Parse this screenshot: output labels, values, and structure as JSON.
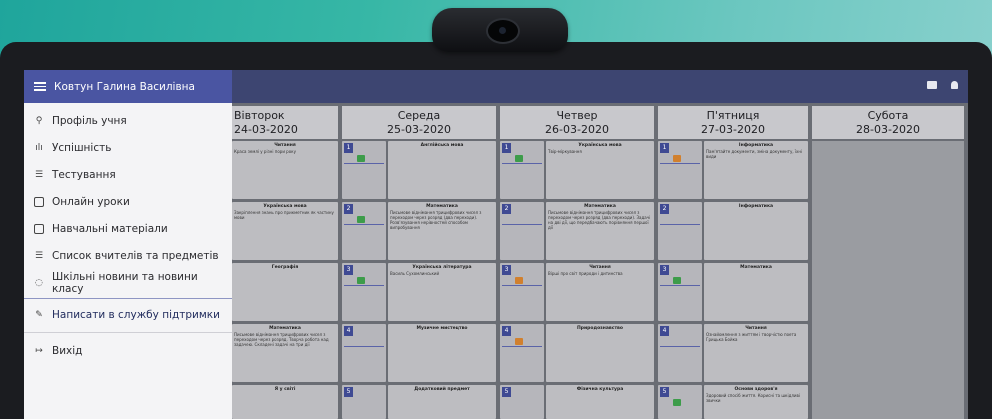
{
  "user": {
    "name": "Ковтун Галина Василівна"
  },
  "topbar": {
    "icons": [
      "mail-icon",
      "bell-icon"
    ]
  },
  "sidebar": {
    "items": [
      {
        "label": "Профіль учня",
        "icon": "person-icon"
      },
      {
        "label": "Успішність",
        "icon": "bar-chart-icon"
      },
      {
        "label": "Тестування",
        "icon": "list-icon"
      },
      {
        "label": "Онлайн уроки",
        "icon": "video-icon"
      },
      {
        "label": "Навчальні матеріали",
        "icon": "book-icon"
      },
      {
        "label": "Список вчителів та предметів",
        "icon": "list-icon"
      },
      {
        "label": "Шкільні новини та новини класу",
        "icon": "chat-icon"
      },
      {
        "label": "Написати в службу підтримки",
        "icon": "pencil-icon"
      },
      {
        "label": "Вихід",
        "icon": "logout-icon"
      }
    ]
  },
  "days": [
    {
      "name": "Вівторок",
      "date": "24-03-2020"
    },
    {
      "name": "Середа",
      "date": "25-03-2020"
    },
    {
      "name": "Четвер",
      "date": "26-03-2020"
    },
    {
      "name": "П'ятниця",
      "date": "27-03-2020"
    },
    {
      "name": "Субота",
      "date": "28-03-2020"
    }
  ],
  "schedule": {
    "tue": [
      {
        "subject": "Читання",
        "note": "Краса землі у різні пори року"
      },
      {
        "subject": "Українська мова",
        "note": "Закріплення знань про прикметник як частину мови"
      },
      {
        "subject": "Географія",
        "note": ""
      },
      {
        "subject": "Математика",
        "note": "Письмове віднімання трицифрових чисел з переходом через розряд. Творча робота над задачею. Складені задачі на три дії"
      },
      {
        "subject": "Я у світі",
        "note": ""
      }
    ],
    "wed": [
      {
        "num": "1",
        "subject": "Англійська мова",
        "note": ""
      },
      {
        "num": "2",
        "subject": "Математика",
        "note": "Письмове віднімання трицифрових чисел з переходом через розряд (два переходи). Розв'язування нерівностей способом випробування"
      },
      {
        "num": "3",
        "subject": "Українська література",
        "note": "Василь Сухомлинський"
      },
      {
        "num": "4",
        "subject": "Музичне мистецтво",
        "note": ""
      },
      {
        "num": "5",
        "subject": "Додатковий предмет",
        "note": ""
      }
    ],
    "thu": [
      {
        "num": "1",
        "subject": "Українська мова",
        "note": "Твір-міркування"
      },
      {
        "num": "2",
        "subject": "Математика",
        "note": "Письмове віднімання трицифрових чисел з переходом через розряд (два переходи). Задачі на дві дії, що передбачають порівняння першої дії"
      },
      {
        "num": "3",
        "subject": "Читання",
        "note": "Вірші про світ природи і дитинства"
      },
      {
        "num": "4",
        "subject": "Природознавство",
        "note": ""
      },
      {
        "num": "5",
        "subject": "Фізична культура",
        "note": ""
      }
    ],
    "fri": [
      {
        "num": "1",
        "subject": "Інформатика",
        "note": "Пам'ятайте документи, зміна документу, їхні види"
      },
      {
        "num": "2",
        "subject": "Інформатика",
        "note": ""
      },
      {
        "num": "3",
        "subject": "Математика",
        "note": ""
      },
      {
        "num": "4",
        "subject": "Читання",
        "note": "Ознайомлення з життям і творчістю поета Грицька Бойка"
      },
      {
        "num": "5",
        "subject": "Основи здоров'я",
        "note": "Здоровий спосіб життя. Корисні та шкідливі звички"
      }
    ]
  }
}
